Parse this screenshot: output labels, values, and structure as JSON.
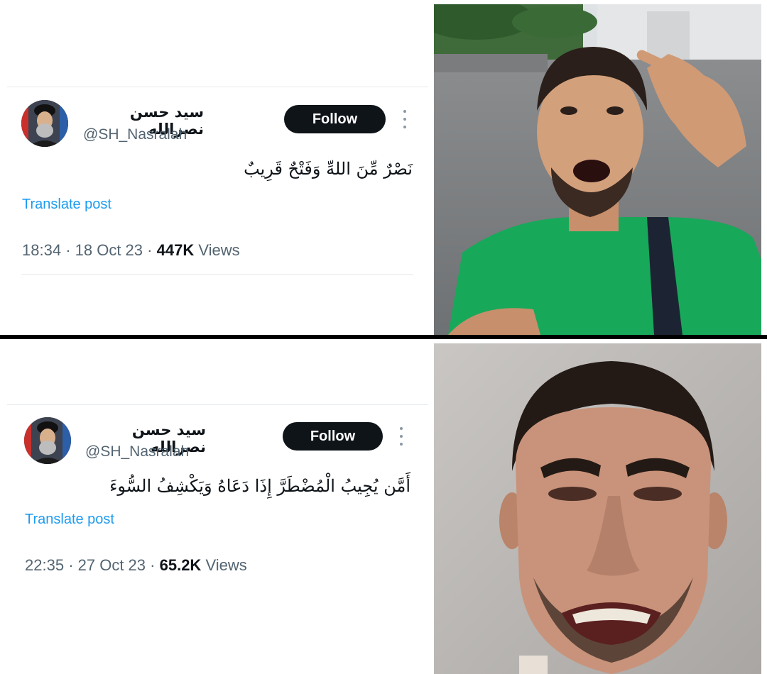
{
  "panels": [
    {
      "tweet": {
        "display_name": "سيد حسن نصرالله",
        "handle": "@SH_Nasralah",
        "follow_label": "Follow",
        "text": "نَصْرٌ مِّنَ اللهِّ وَفَتْحٌ قَرِيبٌ",
        "translate_label": "Translate post",
        "time": "18:34",
        "date": "18 Oct 23",
        "views_count": "447K",
        "views_label": "Views",
        "sep": "·"
      }
    },
    {
      "tweet": {
        "display_name": "سيد حسن نصرالله",
        "handle": "@SH_Nasralah",
        "follow_label": "Follow",
        "text": "أَمَّن يُجِيبُ الْمُضْطَرَّ إِذَا دَعَاهُ وَيَكْشِفُ السُّوءَ",
        "translate_label": "Translate post",
        "time": "22:35",
        "date": "27 Oct 23",
        "views_count": "65.2K",
        "views_label": "Views",
        "sep": "·"
      }
    }
  ],
  "colors": {
    "accent": "#1d9bf0",
    "follow_bg": "#0f1419",
    "muted": "#536471",
    "divider": "#000000",
    "shirt": "#18a85a"
  }
}
